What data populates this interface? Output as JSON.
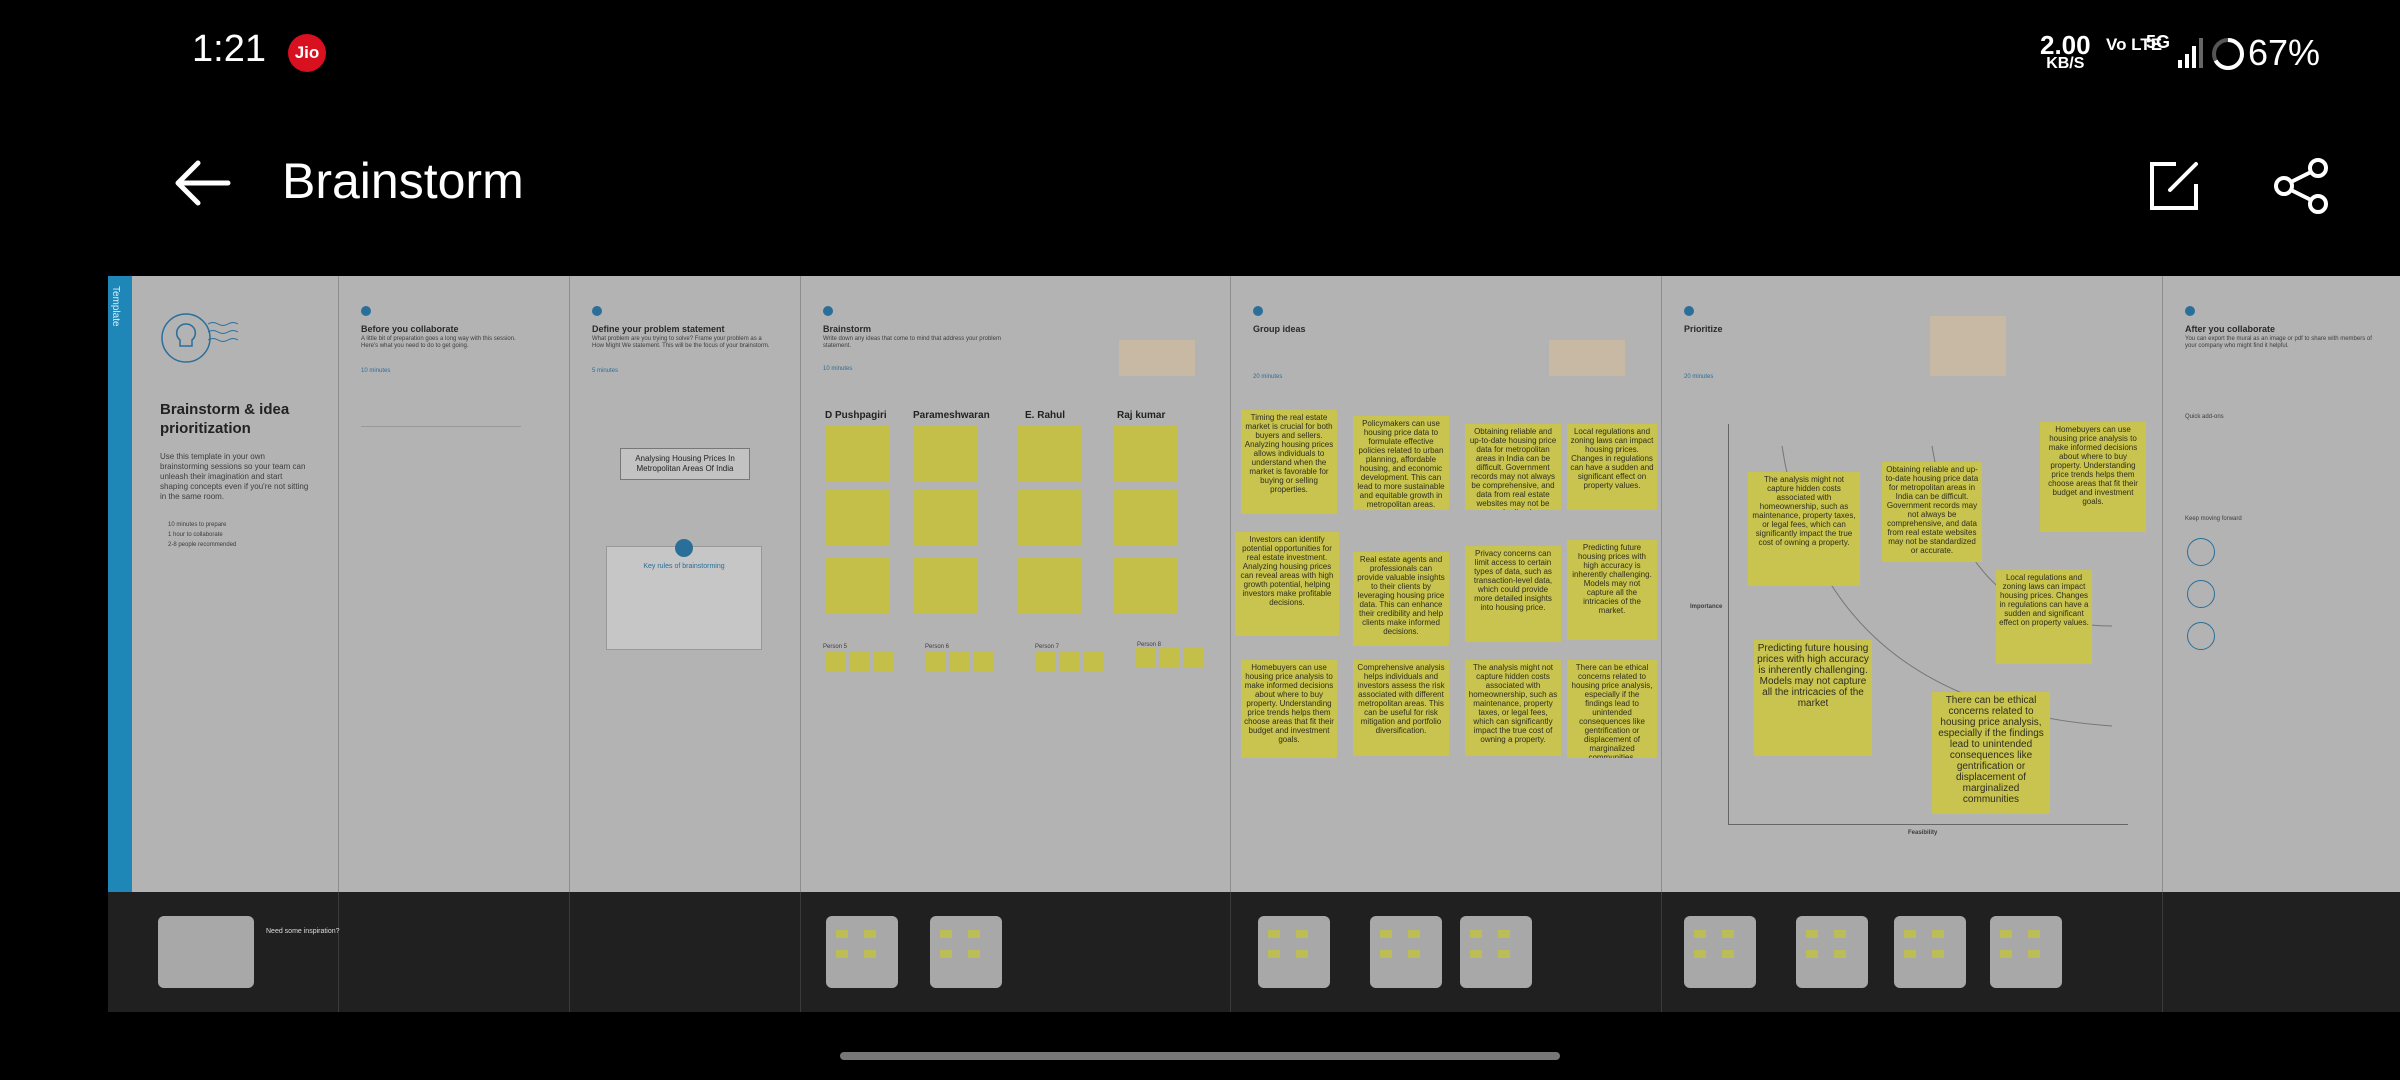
{
  "status_bar": {
    "time": "1:21",
    "carrier_badge": "Jio",
    "speed_value": "2.00",
    "speed_unit": "KB/S",
    "volte": "Vo LTE",
    "network": "5G",
    "battery": "67%"
  },
  "app_bar": {
    "title": "Brainstorm",
    "back_icon": "arrow-left-icon",
    "edit_icon": "edit-icon",
    "share_icon": "share-icon"
  },
  "board": {
    "edge_label": "Template",
    "cover": {
      "title": "Brainstorm & idea prioritization",
      "description": "Use this template in your own brainstorming sessions so your team can unleash their imagination and start shaping concepts even if you're not sitting in the same room.",
      "meta": [
        "10 minutes to prepare",
        "1 hour to collaborate",
        "2-8 people recommended"
      ],
      "inspiration_title": "Need some inspiration?"
    },
    "before": {
      "title": "Before you collaborate",
      "desc": "A little bit of preparation goes a long way with this session. Here's what you need to do to get going.",
      "time": "10 minutes"
    },
    "define": {
      "title": "Define your problem statement",
      "desc": "What problem are you trying to solve? Frame your problem as a How Might We statement. This will be the focus of your brainstorm.",
      "time": "5 minutes",
      "problem_statement": "Analysing Housing Prices In Metropolitan Areas Of India",
      "rules_title": "Key rules of brainstorming"
    },
    "brainstorm": {
      "title": "Brainstorm",
      "desc": "Write down any ideas that come to mind that address your problem statement.",
      "time": "10 minutes",
      "people": [
        "D Pushpagiri",
        "Parameshwaran",
        "E. Rahul",
        "Raj kumar"
      ],
      "person_labels": [
        "Person 5",
        "Person 6",
        "Person 7",
        "Person 8"
      ]
    },
    "group": {
      "title": "Group ideas",
      "time": "20 minutes",
      "notes": [
        "Timing the real estate market is crucial for both buyers and sellers. Analyzing housing prices allows individuals to understand when the market is favorable for buying or selling properties.",
        "Policymakers can use housing price data to formulate effective policies related to urban planning, affordable housing, and economic development. This can lead to more sustainable and equitable growth in metropolitan areas.",
        "Obtaining reliable and up-to-date housing price data for metropolitan areas in India can be difficult. Government records may not always be comprehensive, and data from real estate websites may not be standardized or accurate.",
        "Local regulations and zoning laws can impact housing prices. Changes in regulations can have a sudden and significant effect on property values.",
        "Investors can identify potential opportunities for real estate investment. Analyzing housing prices can reveal areas with high growth potential, helping investors make profitable decisions.",
        "Real estate agents and professionals can provide valuable insights to their clients by leveraging housing price data. This can enhance their credibility and help clients make informed decisions.",
        "Privacy concerns can limit access to certain types of data, such as transaction-level data, which could provide more detailed insights into housing price.",
        "Predicting future housing prices with high accuracy is inherently challenging. Models may not capture all the intricacies of the market.",
        "Homebuyers can use housing price analysis to make informed decisions about where to buy property. Understanding price trends helps them choose areas that fit their budget and investment goals.",
        "Comprehensive analysis helps individuals and investors assess the risk associated with different metropolitan areas. This can be useful for risk mitigation and portfolio diversification.",
        "The analysis might not capture hidden costs associated with homeownership, such as maintenance, property taxes, or legal fees, which can significantly impact the true cost of owning a property.",
        "There can be ethical concerns related to housing price analysis, especially if the findings lead to unintended consequences like gentrification or displacement of marginalized communities."
      ]
    },
    "prioritize": {
      "title": "Prioritize",
      "time": "20 minutes",
      "y_axis": "Importance",
      "x_axis": "Feasibility",
      "notes": [
        "The analysis might not capture hidden costs associated with homeownership, such as maintenance, property taxes, or legal fees, which can significantly impact the true cost of owning a property.",
        "Obtaining reliable and up-to-date housing price data for metropolitan areas in India can be difficult. Government records may not always be comprehensive, and data from real estate websites may not be standardized or accurate.",
        "Homebuyers can use housing price analysis to make informed decisions about where to buy property. Understanding price trends helps them choose areas that fit their budget and investment goals.",
        "Local regulations and zoning laws can impact housing prices. Changes in regulations can have a sudden and significant effect on property values.",
        "Predicting future housing prices with high accuracy is inherently challenging. Models may not capture all the intricacies of the market",
        "There can be ethical concerns related to housing price analysis, especially if the findings lead to unintended consequences like gentrification or displacement of marginalized communities"
      ]
    },
    "after": {
      "title": "After you collaborate",
      "desc": "You can export the mural as an image or pdf to share with members of your company who might find it helpful.",
      "quick_add": "Quick add-ons",
      "keep_moving": "Keep moving forward"
    }
  }
}
